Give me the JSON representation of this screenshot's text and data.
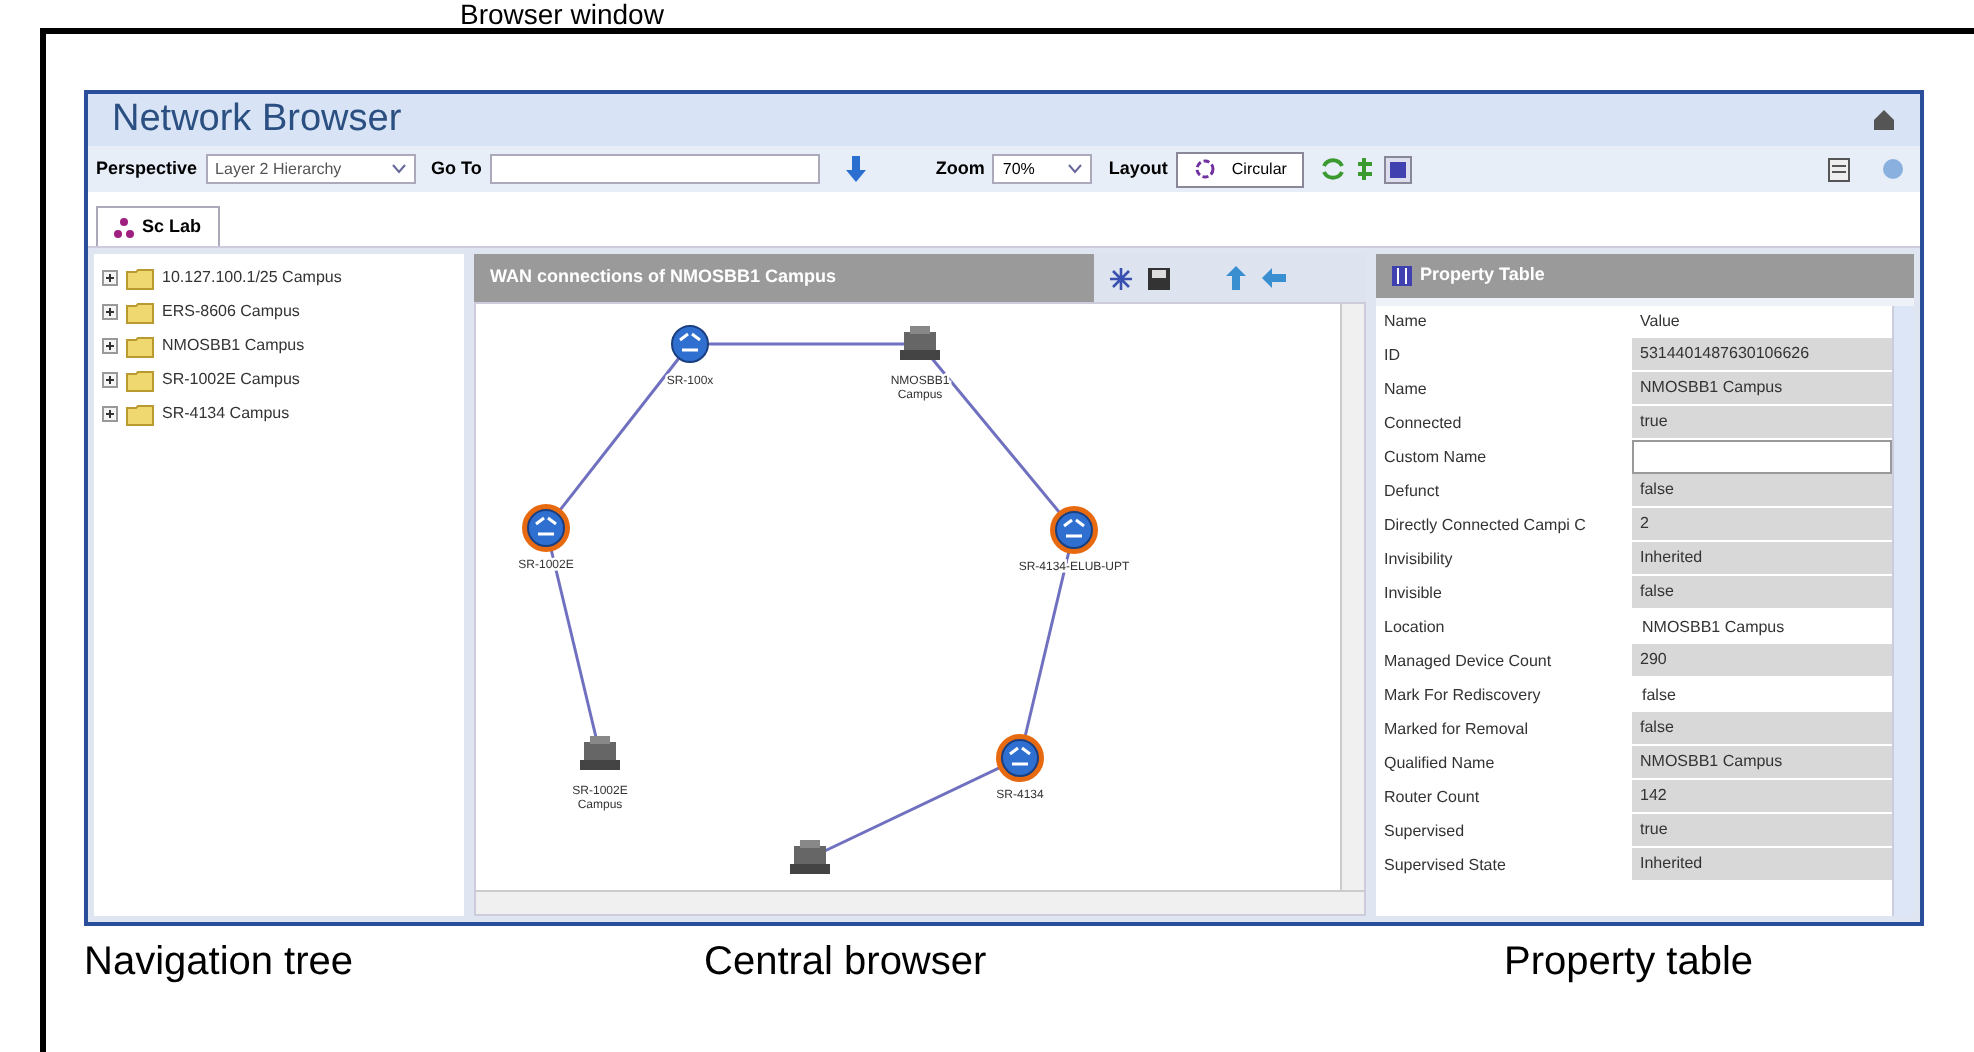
{
  "figure_caption": "Browser window",
  "window": {
    "title": "Network Browser"
  },
  "toolbar": {
    "perspective_label": "Perspective",
    "perspective_value": "Layer 2 Hierarchy",
    "goto_label": "Go To",
    "zoom_label": "Zoom",
    "zoom_value": "70%",
    "layout_label": "Layout",
    "layout_button": "Circular"
  },
  "tabs": [
    {
      "label": "Sc Lab",
      "selected": true
    }
  ],
  "navigation_tree": {
    "items": [
      {
        "label": "10.127.100.1/25 Campus",
        "expanded": false
      },
      {
        "label": "ERS-8606 Campus",
        "expanded": false
      },
      {
        "label": "NMOSBB1 Campus",
        "expanded": false
      },
      {
        "label": "SR-1002E Campus",
        "expanded": false
      },
      {
        "label": "SR-4134 Campus",
        "expanded": false
      }
    ]
  },
  "central_browser": {
    "title": "WAN connections of NMOSBB1 Campus",
    "nodes": [
      {
        "kind": "router",
        "label": "SR-100x"
      },
      {
        "kind": "switch",
        "label": "NMOSBB1 Campus"
      },
      {
        "kind": "flagged_router",
        "label": "SR-1002E"
      },
      {
        "kind": "flagged_router",
        "label": "SR-4134-ELUB-UPT"
      },
      {
        "kind": "switch",
        "label": "SR-1002E Campus"
      },
      {
        "kind": "flagged_router",
        "label": "SR-4134"
      },
      {
        "kind": "switch"
      }
    ]
  },
  "property_table": {
    "title": "Property Table",
    "columns": [
      "Name",
      "Value"
    ],
    "rows": [
      {
        "name": "ID",
        "value": "5314401487630106626",
        "editable": false
      },
      {
        "name": "Name",
        "value": "NMOSBB1 Campus",
        "editable": false
      },
      {
        "name": "Connected",
        "value": "true",
        "editable": false
      },
      {
        "name": "Custom Name",
        "value": "",
        "editable": true
      },
      {
        "name": "Defunct",
        "value": "false",
        "editable": false
      },
      {
        "name": "Directly Connected Campi C",
        "value": "2",
        "editable": false
      },
      {
        "name": "Invisibility",
        "value": "Inherited",
        "editable": false
      },
      {
        "name": "Invisible",
        "value": "false",
        "editable": false
      },
      {
        "name": "Location",
        "value": "NMOSBB1 Campus",
        "editable": true
      },
      {
        "name": "Managed Device Count",
        "value": "290",
        "editable": false
      },
      {
        "name": "Mark For Rediscovery",
        "value": "false",
        "editable": true
      },
      {
        "name": "Marked for Removal",
        "value": "false",
        "editable": false
      },
      {
        "name": "Qualified Name",
        "value": "NMOSBB1 Campus",
        "editable": false
      },
      {
        "name": "Router Count",
        "value": "142",
        "editable": false
      },
      {
        "name": "Supervised",
        "value": "true",
        "editable": false
      },
      {
        "name": "Supervised State",
        "value": "Inherited",
        "editable": false
      }
    ]
  },
  "captions": [
    "Navigation tree",
    "Central browser",
    "Property table"
  ]
}
